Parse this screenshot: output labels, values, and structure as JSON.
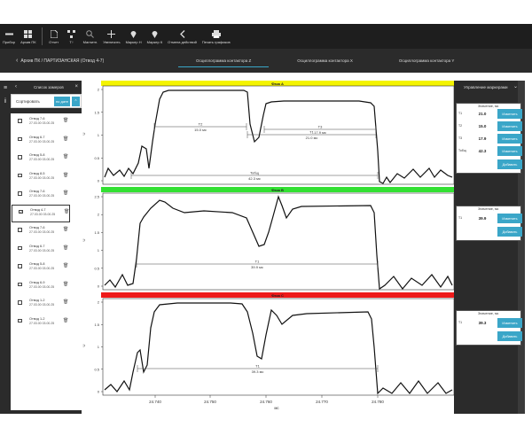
{
  "toolbar": {
    "items": [
      {
        "label": "Прибор",
        "icon": "minus-icon"
      },
      {
        "label": "Архив ПК",
        "icon": "grid-icon"
      },
      {
        "label": "Отчет",
        "icon": "document-icon"
      },
      {
        "label": "T↑",
        "icon": "network-icon"
      },
      {
        "label": "Магнитн.",
        "icon": "magnifier-icon"
      },
      {
        "label": "Увеличить",
        "icon": "move-icon"
      },
      {
        "label": "Маркер Н",
        "icon": "pin-icon"
      },
      {
        "label": "Маркер К",
        "icon": "pin-icon"
      },
      {
        "label": "Отмена действий",
        "icon": "chevron-left-icon"
      },
      {
        "label": "Печать графиков",
        "icon": "printer-icon"
      }
    ]
  },
  "breadcrumb": {
    "text": "Архив ПК / ПАРТИЗАНСКАЯ (Отвод 4-7)"
  },
  "tabs": [
    "Осциллограмма контактора Z",
    "Осциллограмма контактора X",
    "Осциллограмма контактора Y"
  ],
  "left_panel": {
    "title": "Список замеров",
    "sort_label": "Сортировать",
    "sort_button": "по дате",
    "items": [
      {
        "name": "Отвод 7-6",
        "date": "27.03.00 03.00.25",
        "checked": false
      },
      {
        "name": "Отвод 6-7",
        "date": "27.03.00 03.00.25",
        "checked": false
      },
      {
        "name": "Отвод 5-8",
        "date": "27.03.00 03.00.25",
        "checked": false
      },
      {
        "name": "Отвод 8-5",
        "date": "27.03.00 03.00.25",
        "checked": false
      },
      {
        "name": "Отвод 7-6",
        "date": "27.03.00 03.00.25",
        "checked": false
      },
      {
        "name": "Отвод 4-7",
        "date": "27.03.00 03.00.25",
        "checked": true
      },
      {
        "name": "Отвод 7-6",
        "date": "27.03.00 03.00.25",
        "checked": false
      },
      {
        "name": "Отвод 6-7",
        "date": "27.03.00 03.00.25",
        "checked": false
      },
      {
        "name": "Отвод 5-8",
        "date": "27.03.00 03.00.25",
        "checked": false
      },
      {
        "name": "Отвод 6-9",
        "date": "27.03.00 03.00.25",
        "checked": false
      },
      {
        "name": "Отвод 1-2",
        "date": "27.03.00 03.00.25",
        "checked": false
      },
      {
        "name": "Отвод 1-2",
        "date": "27.03.00 03.00.25",
        "checked": false
      }
    ]
  },
  "right_panel": {
    "title": "Управление маркерами",
    "card1": {
      "header": "Значение, мс",
      "rows": [
        {
          "key": "T1",
          "value": "21.0",
          "button": "Изменить"
        },
        {
          "key": "T2",
          "value": "15.0",
          "button": "Изменить"
        },
        {
          "key": "T3",
          "value": "17.9",
          "button": "Изменить"
        },
        {
          "key": "Тобщ",
          "value": "42.3",
          "button": "Изменить"
        }
      ],
      "add": "Добавить"
    },
    "card2": {
      "header": "Значение, мс",
      "key": "T1",
      "value": "39.9",
      "button": "Изменить",
      "add": "Добавить"
    },
    "card3": {
      "header": "Значение, мс",
      "key": "T1",
      "value": "39.3",
      "button": "Изменить",
      "add": "Добавить"
    }
  },
  "phases": [
    {
      "label": "Фаза A",
      "color": "#f4f400"
    },
    {
      "label": "Фаза B",
      "color": "#33e033"
    },
    {
      "label": "Фаза C",
      "color": "#ee1a1a"
    }
  ],
  "chart_data": [
    {
      "type": "line",
      "title": "Фаза A",
      "ylabel": "U",
      "ylim": [
        0,
        2
      ],
      "yticks": [
        "2",
        "1.5",
        "1",
        "0.5",
        "0"
      ],
      "markers": [
        {
          "label": "T2",
          "value": "15.0 мс"
        },
        {
          "label": "T3",
          "value": "17.9 мс"
        },
        {
          "label": "T1",
          "value": "21.0 мс"
        },
        {
          "label": "Тобщ",
          "value": "42.3 мс"
        }
      ]
    },
    {
      "type": "line",
      "title": "Фаза B",
      "ylabel": "U",
      "ylim": [
        0,
        2.5
      ],
      "yticks": [
        "2.5",
        "2",
        "1.5",
        "1",
        "0.5",
        "0"
      ],
      "markers": [
        {
          "label": "T1",
          "value": "39.9 мс"
        }
      ]
    },
    {
      "type": "line",
      "title": "Фаза C",
      "ylabel": "U",
      "ylim": [
        0,
        2
      ],
      "yticks": [
        "2",
        "1.5",
        "1",
        "0.5",
        "0"
      ],
      "markers": [
        {
          "label": "T1",
          "value": "39.3 мс"
        }
      ],
      "xlabel": "мс",
      "xticks": [
        "24.740",
        "24.750",
        "24.760",
        "24.770",
        "24.780"
      ]
    }
  ]
}
